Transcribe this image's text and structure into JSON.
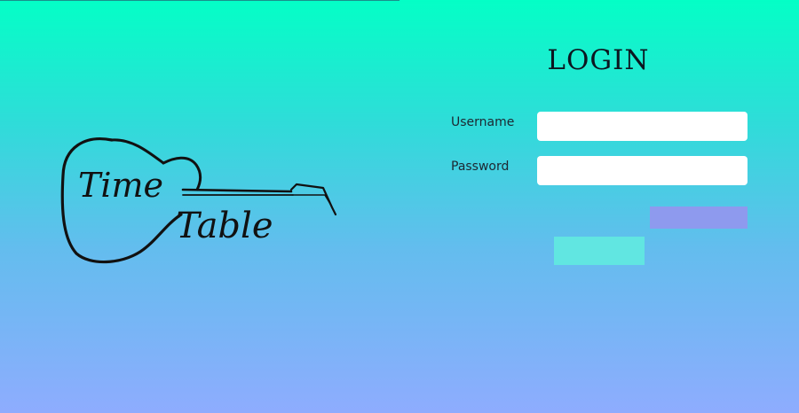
{
  "logo": {
    "line1": "Time",
    "line2": "Table"
  },
  "login": {
    "title": "LOGIN",
    "username_label": "Username",
    "username_value": "",
    "password_label": "Password",
    "password_value": "",
    "login_button_label": "",
    "register_button_label": ""
  },
  "colors": {
    "gradient_top": "#04ffc6",
    "gradient_bottom": "#8eacfe",
    "login_button": "#8e9aee",
    "secondary_button": "#61e6e1",
    "input_background": "#ffffff"
  }
}
